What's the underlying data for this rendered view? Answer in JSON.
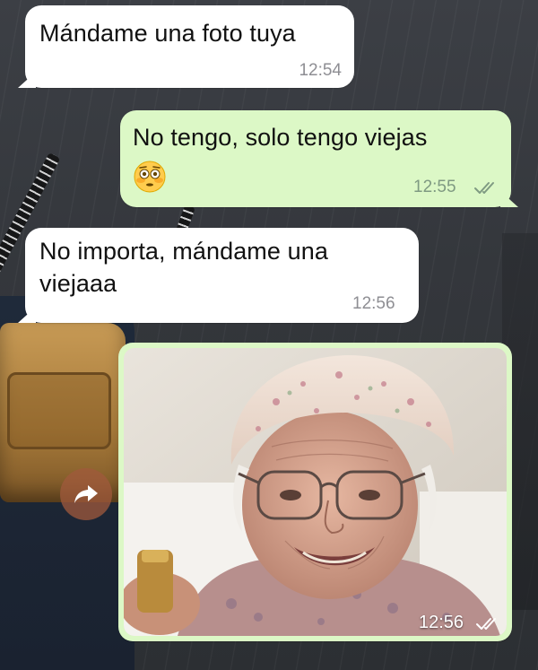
{
  "messages": [
    {
      "direction": "incoming",
      "text": "Mándame una foto tuya",
      "time": "12:54"
    },
    {
      "direction": "outgoing",
      "text": "No tengo, solo tengo viejas",
      "emoji": "flushed-face",
      "time": "12:55",
      "status": "read"
    },
    {
      "direction": "incoming",
      "text": "No importa, mándame una viejaaa",
      "time": "12:56"
    },
    {
      "direction": "outgoing",
      "type": "image",
      "image_desc": "elderly-woman-photo",
      "time": "12:56",
      "status": "read"
    }
  ],
  "forward_icon": "forward-arrow-icon",
  "colors": {
    "incoming_bubble": "#ffffff",
    "outgoing_bubble": "#dcf8c6",
    "time_gray": "#8e8e93",
    "forward_button": "#a05a3c"
  }
}
